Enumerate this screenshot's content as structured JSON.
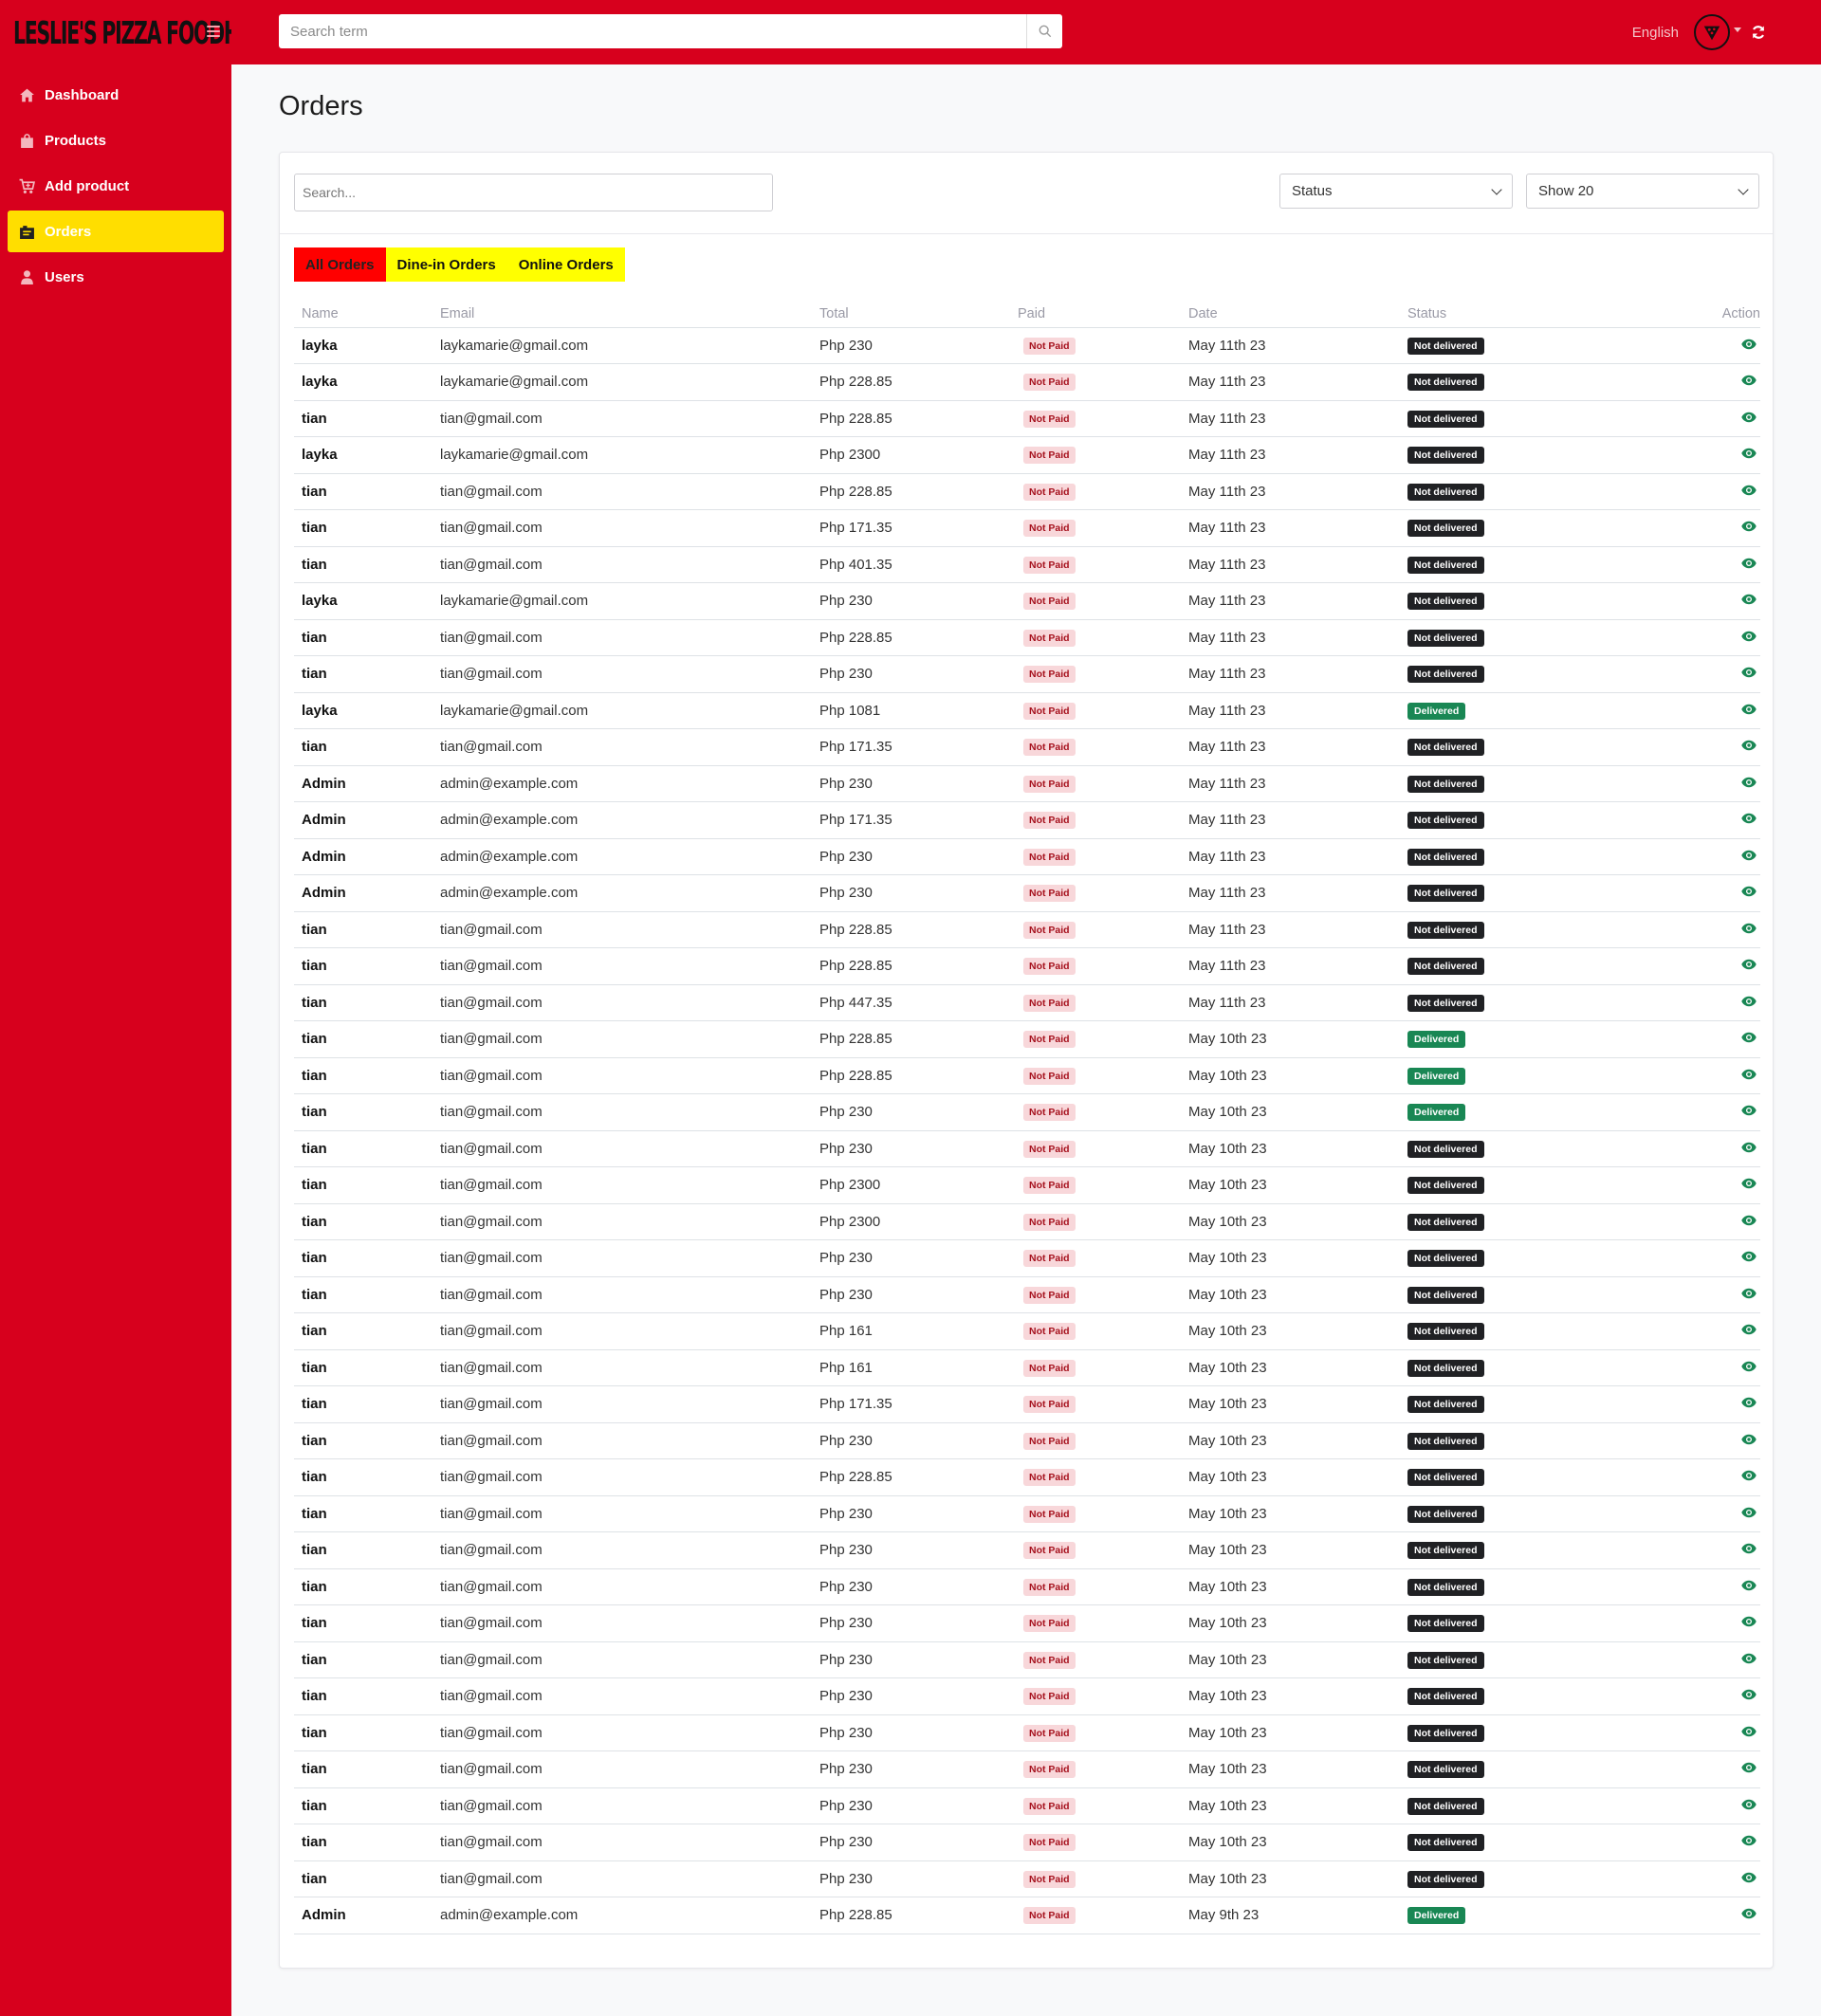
{
  "brand": {
    "logo_text": "LESLIE'S PIZZA FOODHUB"
  },
  "sidebar": {
    "items": [
      {
        "label": "Dashboard",
        "icon": "home-icon"
      },
      {
        "label": "Products",
        "icon": "bag-icon"
      },
      {
        "label": "Add product",
        "icon": "cart-icon"
      },
      {
        "label": "Orders",
        "icon": "orders-icon",
        "active": true
      },
      {
        "label": "Users",
        "icon": "user-icon"
      }
    ]
  },
  "topbar": {
    "search_placeholder": "Search term",
    "language": "English"
  },
  "page": {
    "title": "Orders"
  },
  "filters": {
    "search_placeholder": "Search...",
    "status_label": "Status",
    "show_label": "Show 20"
  },
  "tabs": [
    {
      "label": "All Orders",
      "active": true
    },
    {
      "label": "Dine-in Orders"
    },
    {
      "label": "Online Orders"
    }
  ],
  "table": {
    "headers": {
      "name": "Name",
      "email": "Email",
      "total": "Total",
      "paid": "Paid",
      "date": "Date",
      "status": "Status",
      "action": "Action"
    },
    "rows": [
      [
        "layka",
        "laykamarie@gmail.com",
        "Php 230",
        "Not Paid",
        "May 11th 23",
        "Not delivered"
      ],
      [
        "layka",
        "laykamarie@gmail.com",
        "Php 228.85",
        "Not Paid",
        "May 11th 23",
        "Not delivered"
      ],
      [
        "tian",
        "tian@gmail.com",
        "Php 228.85",
        "Not Paid",
        "May 11th 23",
        "Not delivered"
      ],
      [
        "layka",
        "laykamarie@gmail.com",
        "Php 2300",
        "Not Paid",
        "May 11th 23",
        "Not delivered"
      ],
      [
        "tian",
        "tian@gmail.com",
        "Php 228.85",
        "Not Paid",
        "May 11th 23",
        "Not delivered"
      ],
      [
        "tian",
        "tian@gmail.com",
        "Php 171.35",
        "Not Paid",
        "May 11th 23",
        "Not delivered"
      ],
      [
        "tian",
        "tian@gmail.com",
        "Php 401.35",
        "Not Paid",
        "May 11th 23",
        "Not delivered"
      ],
      [
        "layka",
        "laykamarie@gmail.com",
        "Php 230",
        "Not Paid",
        "May 11th 23",
        "Not delivered"
      ],
      [
        "tian",
        "tian@gmail.com",
        "Php 228.85",
        "Not Paid",
        "May 11th 23",
        "Not delivered"
      ],
      [
        "tian",
        "tian@gmail.com",
        "Php 230",
        "Not Paid",
        "May 11th 23",
        "Not delivered"
      ],
      [
        "layka",
        "laykamarie@gmail.com",
        "Php 1081",
        "Not Paid",
        "May 11th 23",
        "Delivered"
      ],
      [
        "tian",
        "tian@gmail.com",
        "Php 171.35",
        "Not Paid",
        "May 11th 23",
        "Not delivered"
      ],
      [
        "Admin",
        "admin@example.com",
        "Php 230",
        "Not Paid",
        "May 11th 23",
        "Not delivered"
      ],
      [
        "Admin",
        "admin@example.com",
        "Php 171.35",
        "Not Paid",
        "May 11th 23",
        "Not delivered"
      ],
      [
        "Admin",
        "admin@example.com",
        "Php 230",
        "Not Paid",
        "May 11th 23",
        "Not delivered"
      ],
      [
        "Admin",
        "admin@example.com",
        "Php 230",
        "Not Paid",
        "May 11th 23",
        "Not delivered"
      ],
      [
        "tian",
        "tian@gmail.com",
        "Php 228.85",
        "Not Paid",
        "May 11th 23",
        "Not delivered"
      ],
      [
        "tian",
        "tian@gmail.com",
        "Php 228.85",
        "Not Paid",
        "May 11th 23",
        "Not delivered"
      ],
      [
        "tian",
        "tian@gmail.com",
        "Php 447.35",
        "Not Paid",
        "May 11th 23",
        "Not delivered"
      ],
      [
        "tian",
        "tian@gmail.com",
        "Php 228.85",
        "Not Paid",
        "May 10th 23",
        "Delivered"
      ],
      [
        "tian",
        "tian@gmail.com",
        "Php 228.85",
        "Not Paid",
        "May 10th 23",
        "Delivered"
      ],
      [
        "tian",
        "tian@gmail.com",
        "Php 230",
        "Not Paid",
        "May 10th 23",
        "Delivered"
      ],
      [
        "tian",
        "tian@gmail.com",
        "Php 230",
        "Not Paid",
        "May 10th 23",
        "Not delivered"
      ],
      [
        "tian",
        "tian@gmail.com",
        "Php 2300",
        "Not Paid",
        "May 10th 23",
        "Not delivered"
      ],
      [
        "tian",
        "tian@gmail.com",
        "Php 2300",
        "Not Paid",
        "May 10th 23",
        "Not delivered"
      ],
      [
        "tian",
        "tian@gmail.com",
        "Php 230",
        "Not Paid",
        "May 10th 23",
        "Not delivered"
      ],
      [
        "tian",
        "tian@gmail.com",
        "Php 230",
        "Not Paid",
        "May 10th 23",
        "Not delivered"
      ],
      [
        "tian",
        "tian@gmail.com",
        "Php 161",
        "Not Paid",
        "May 10th 23",
        "Not delivered"
      ],
      [
        "tian",
        "tian@gmail.com",
        "Php 161",
        "Not Paid",
        "May 10th 23",
        "Not delivered"
      ],
      [
        "tian",
        "tian@gmail.com",
        "Php 171.35",
        "Not Paid",
        "May 10th 23",
        "Not delivered"
      ],
      [
        "tian",
        "tian@gmail.com",
        "Php 230",
        "Not Paid",
        "May 10th 23",
        "Not delivered"
      ],
      [
        "tian",
        "tian@gmail.com",
        "Php 228.85",
        "Not Paid",
        "May 10th 23",
        "Not delivered"
      ],
      [
        "tian",
        "tian@gmail.com",
        "Php 230",
        "Not Paid",
        "May 10th 23",
        "Not delivered"
      ],
      [
        "tian",
        "tian@gmail.com",
        "Php 230",
        "Not Paid",
        "May 10th 23",
        "Not delivered"
      ],
      [
        "tian",
        "tian@gmail.com",
        "Php 230",
        "Not Paid",
        "May 10th 23",
        "Not delivered"
      ],
      [
        "tian",
        "tian@gmail.com",
        "Php 230",
        "Not Paid",
        "May 10th 23",
        "Not delivered"
      ],
      [
        "tian",
        "tian@gmail.com",
        "Php 230",
        "Not Paid",
        "May 10th 23",
        "Not delivered"
      ],
      [
        "tian",
        "tian@gmail.com",
        "Php 230",
        "Not Paid",
        "May 10th 23",
        "Not delivered"
      ],
      [
        "tian",
        "tian@gmail.com",
        "Php 230",
        "Not Paid",
        "May 10th 23",
        "Not delivered"
      ],
      [
        "tian",
        "tian@gmail.com",
        "Php 230",
        "Not Paid",
        "May 10th 23",
        "Not delivered"
      ],
      [
        "tian",
        "tian@gmail.com",
        "Php 230",
        "Not Paid",
        "May 10th 23",
        "Not delivered"
      ],
      [
        "tian",
        "tian@gmail.com",
        "Php 230",
        "Not Paid",
        "May 10th 23",
        "Not delivered"
      ],
      [
        "tian",
        "tian@gmail.com",
        "Php 230",
        "Not Paid",
        "May 10th 23",
        "Not delivered"
      ],
      [
        "Admin",
        "admin@example.com",
        "Php 228.85",
        "Not Paid",
        "May 9th 23",
        "Delivered"
      ]
    ]
  },
  "colors": {
    "brand_red": "#d7001d",
    "active_yellow": "#ffde00",
    "tab_yellow": "#ffff00",
    "tab_active_red": "#ff0000",
    "delivered_green": "#198754",
    "not_delivered_dark": "#202124",
    "not_paid_bg": "#f8d7da",
    "action_icon_green": "#198754"
  }
}
